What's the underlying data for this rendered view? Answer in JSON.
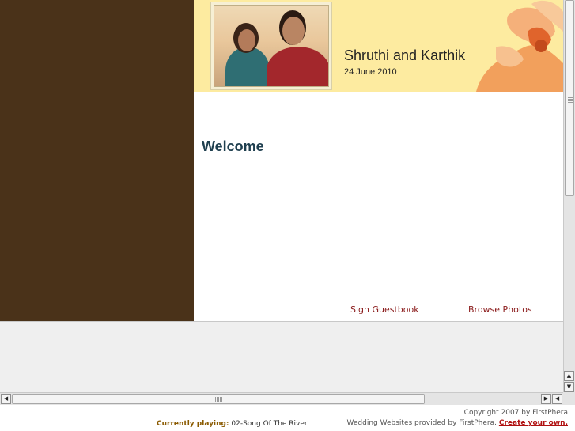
{
  "header": {
    "couple_name": "Shruthi and Karthik",
    "wedding_date": "24 June 2010"
  },
  "main": {
    "welcome_heading": "Welcome"
  },
  "nav": {
    "sign_guestbook": "Sign Guestbook",
    "browse_photos": "Browse Photos"
  },
  "footer": {
    "now_playing_label": "Currently playing:",
    "now_playing_track": "02-Song Of The River",
    "copyright": "Copyright 2007 by FirstPhera",
    "provided_by": "Wedding Websites provided by FirstPhera.",
    "create_own": "Create your own."
  },
  "colors": {
    "left_panel": "#4a3219",
    "header_bg": "#fdeba0",
    "heading": "#1f3f4f",
    "link": "#8a1a1a",
    "create_own_link": "#b01010"
  },
  "icons": {
    "scroll_up": "triangle-up-icon",
    "scroll_down": "triangle-down-icon",
    "scroll_left": "triangle-left-icon",
    "scroll_right": "triangle-right-icon"
  }
}
